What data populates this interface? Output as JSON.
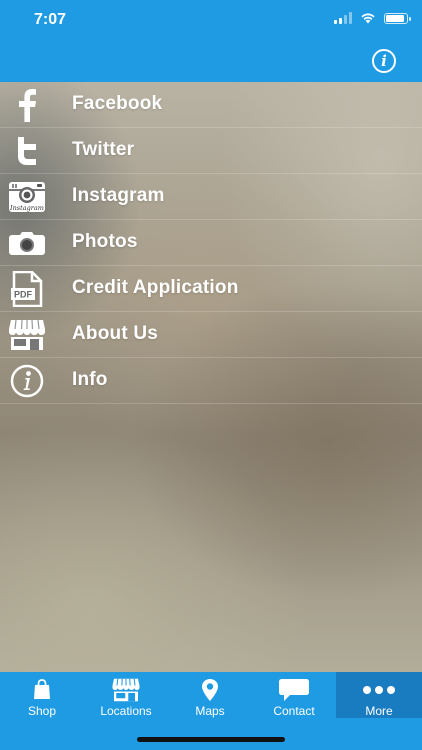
{
  "status_bar": {
    "time": "7:07"
  },
  "nav": {
    "info_icon": "info-icon"
  },
  "menu": {
    "items": [
      {
        "label": "Facebook",
        "icon": "facebook-icon"
      },
      {
        "label": "Twitter",
        "icon": "twitter-icon"
      },
      {
        "label": "Instagram",
        "icon": "instagram-icon"
      },
      {
        "label": "Photos",
        "icon": "camera-icon"
      },
      {
        "label": "Credit Application",
        "icon": "pdf-icon"
      },
      {
        "label": "About Us",
        "icon": "storefront-icon"
      },
      {
        "label": "Info",
        "icon": "info-icon"
      }
    ],
    "instagram_icon_text": "Instagram",
    "pdf_icon_text": "PDF"
  },
  "tab_bar": {
    "tabs": [
      {
        "label": "Shop",
        "icon": "shopping-bag-icon"
      },
      {
        "label": "Locations",
        "icon": "storefront-icon"
      },
      {
        "label": "Maps",
        "icon": "map-pin-icon"
      },
      {
        "label": "Contact",
        "icon": "chat-bubble-icon"
      },
      {
        "label": "More",
        "icon": "more-dots-icon"
      }
    ],
    "active_tab": "More"
  },
  "colors": {
    "brand_blue": "#1f9be3",
    "active_tab_bg": "#1a7cc0"
  }
}
